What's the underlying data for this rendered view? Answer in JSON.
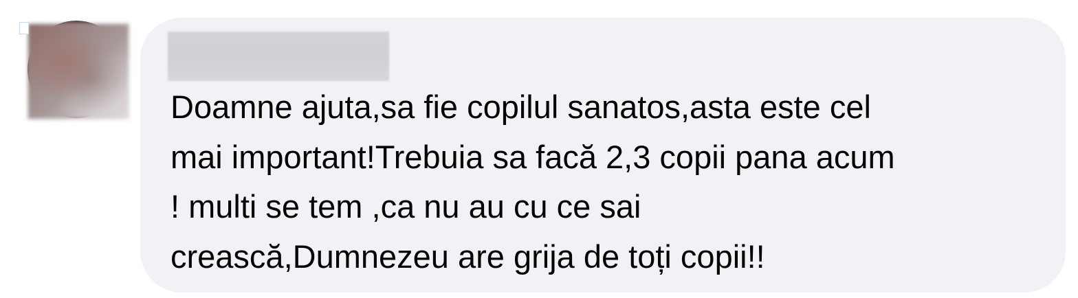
{
  "comment": {
    "lines": [
      "Doamne ajuta,sa fie copilul sanatos,asta este cel",
      "mai important!Trebuia sa facă 2,3 copii pana acum",
      "! multi se tem ,ca nu au cu ce sai",
      "crească,Dumnezeu are grija de toți copii!!"
    ]
  },
  "colors": {
    "bubble_background": "#f0f2f5",
    "text": "#050505"
  },
  "icons": {
    "avatar": "user-avatar-blurred"
  }
}
